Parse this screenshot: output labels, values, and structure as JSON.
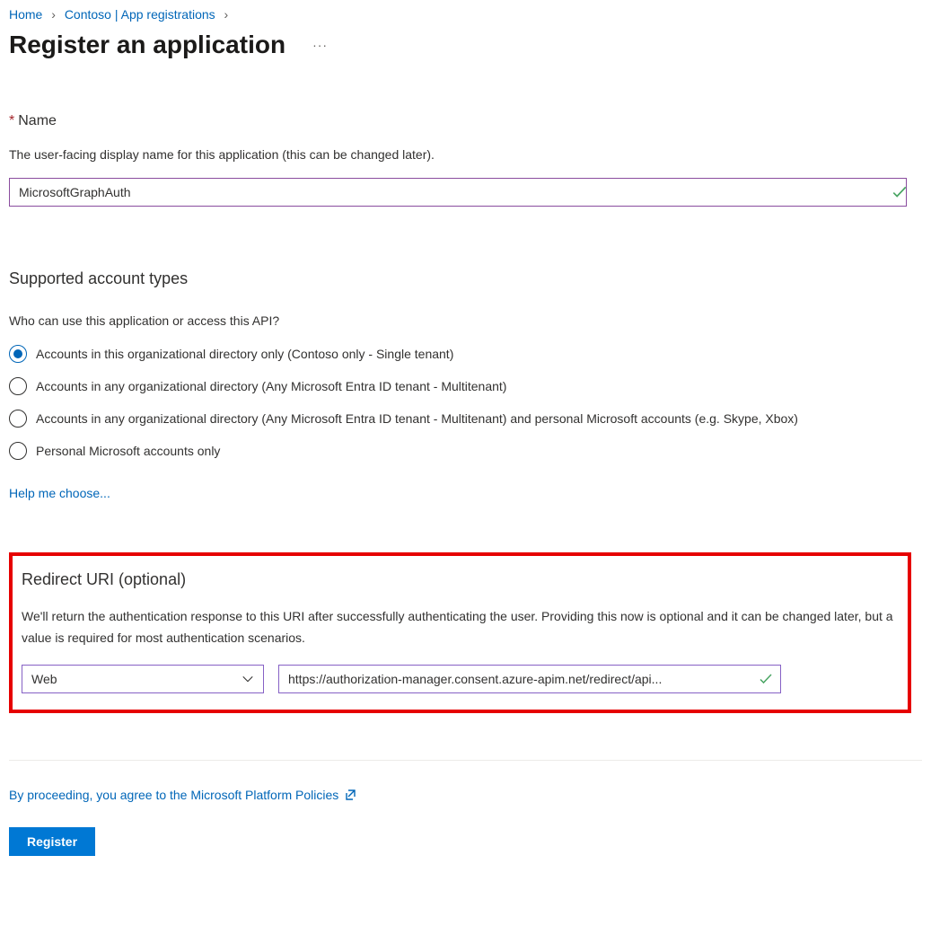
{
  "breadcrumb": {
    "home": "Home",
    "mid": "Contoso | App registrations"
  },
  "page": {
    "title": "Register an application"
  },
  "name": {
    "label": "Name",
    "hint": "The user-facing display name for this application (this can be changed later).",
    "value": "MicrosoftGraphAuth"
  },
  "accountTypes": {
    "heading": "Supported account types",
    "question": "Who can use this application or access this API?",
    "options": [
      {
        "label": "Accounts in this organizational directory only (Contoso only - Single tenant)",
        "selected": true
      },
      {
        "label": "Accounts in any organizational directory (Any Microsoft Entra ID tenant - Multitenant)",
        "selected": false
      },
      {
        "label": "Accounts in any organizational directory (Any Microsoft Entra ID tenant - Multitenant) and personal Microsoft accounts (e.g. Skype, Xbox)",
        "selected": false
      },
      {
        "label": "Personal Microsoft accounts only",
        "selected": false
      }
    ],
    "help": "Help me choose..."
  },
  "redirect": {
    "heading": "Redirect URI (optional)",
    "description": "We'll return the authentication response to this URI after successfully authenticating the user. Providing this now is optional and it can be changed later, but a value is required for most authentication scenarios.",
    "platform": "Web",
    "uri": "https://authorization-manager.consent.azure-apim.net/redirect/api..."
  },
  "footer": {
    "agree": "By proceeding, you agree to the Microsoft Platform Policies",
    "register": "Register"
  }
}
